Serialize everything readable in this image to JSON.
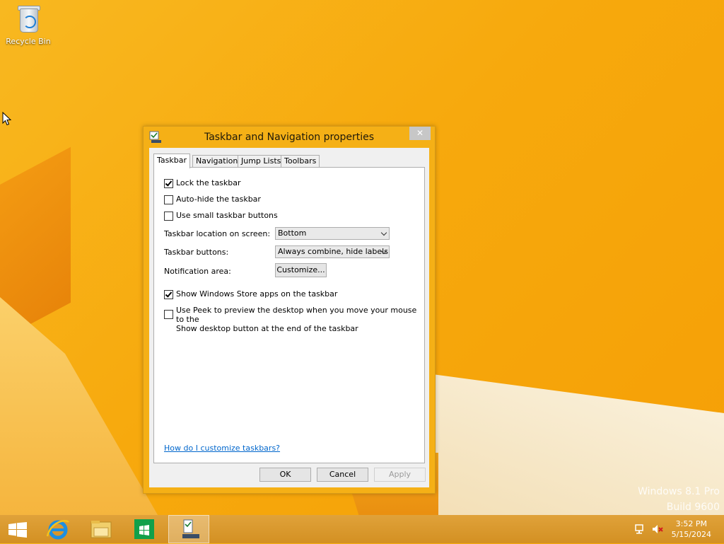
{
  "desktop": {
    "icons": [
      {
        "label": "Recycle Bin",
        "icon": "recycle-bin-icon"
      }
    ],
    "watermark_line1": "Windows 8.1 Pro",
    "watermark_line2": "Build 9600"
  },
  "dialog": {
    "title": "Taskbar and Navigation properties",
    "close_label": "✕",
    "tabs": [
      {
        "label": "Taskbar",
        "active": true
      },
      {
        "label": "Navigation",
        "active": false
      },
      {
        "label": "Jump Lists",
        "active": false
      },
      {
        "label": "Toolbars",
        "active": false
      }
    ],
    "taskbar_tab": {
      "lock_taskbar": {
        "label": "Lock the taskbar",
        "checked": true
      },
      "auto_hide": {
        "label": "Auto-hide the taskbar",
        "checked": false
      },
      "small_buttons": {
        "label": "Use small taskbar buttons",
        "checked": false
      },
      "location_label": "Taskbar location on screen:",
      "location_value": "Bottom",
      "buttons_label": "Taskbar buttons:",
      "buttons_value": "Always combine, hide labels",
      "notification_label": "Notification area:",
      "customize_label": "Customize...",
      "store_apps": {
        "label": "Show Windows Store apps on the taskbar",
        "checked": true
      },
      "peek": {
        "label_line1": "Use Peek to preview the desktop when you move your mouse to the",
        "label_line2": "Show desktop button at the end of the taskbar",
        "checked": false
      },
      "help_link": "How do I customize taskbars?"
    },
    "buttons": {
      "ok": "OK",
      "cancel": "Cancel",
      "apply": "Apply"
    }
  },
  "taskbar": {
    "items": [
      "start-icon",
      "internet-explorer-icon",
      "file-explorer-icon",
      "windows-store-icon",
      "taskbar-properties-icon"
    ],
    "clock_time": "3:52 PM",
    "clock_date": "5/15/2024"
  },
  "colors": {
    "accent": "#f5b016",
    "link": "#0066cc",
    "desktop": "#f7a90d"
  }
}
